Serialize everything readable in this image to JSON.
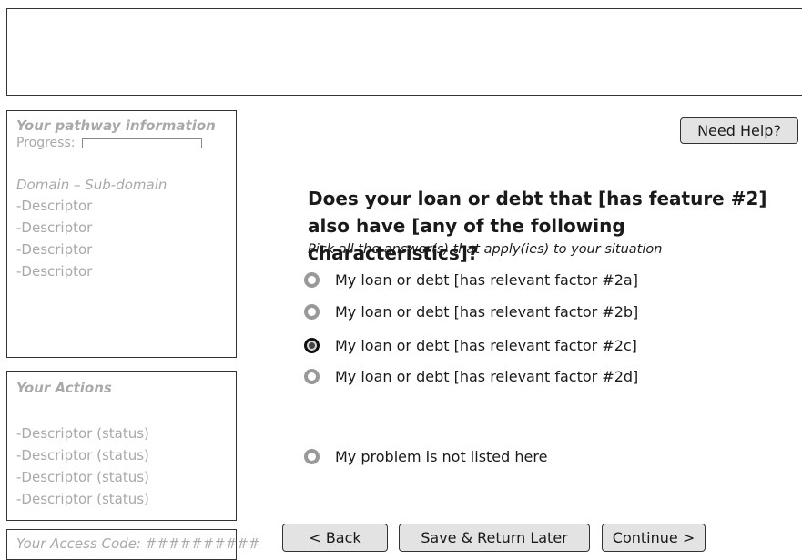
{
  "sidebar": {
    "pathway_title": "Your pathway information",
    "progress_label": "Progress:",
    "domain": "Domain – Sub-domain",
    "descriptors": [
      "-Descriptor",
      "-Descriptor",
      "-Descriptor",
      "-Descriptor"
    ],
    "actions_title": "Your Actions",
    "actions": [
      "-Descriptor (status)",
      "-Descriptor (status)",
      "-Descriptor (status)",
      "-Descriptor (status)"
    ],
    "access_code": "Your Access Code: ##########"
  },
  "help_button": "Need Help?",
  "question": {
    "title": "Does your loan or debt that [has feature #2] also have [any of the following characteristics]?",
    "instruction": "Pick all the answer(s) that apply(ies) to your situation",
    "options": [
      {
        "label": "My loan or debt [has relevant factor #2a]",
        "selected": false
      },
      {
        "label": "My loan or debt [has relevant factor #2b]",
        "selected": false
      },
      {
        "label": "My loan or debt [has relevant factor #2c]",
        "selected": true
      },
      {
        "label": "My loan or debt [has relevant factor #2d]",
        "selected": false
      },
      {
        "label": "My problem is not listed here",
        "selected": false
      }
    ]
  },
  "nav": {
    "back": "< Back",
    "save": "Save & Return Later",
    "continue": "Continue >"
  },
  "colors": {
    "muted_text": "#a9a9a9",
    "button_bg": "#e3e3e3",
    "radio_border": "#999999",
    "border": "#333333"
  },
  "icons": {
    "radio_unselected": "radio-unselected-icon",
    "radio_selected": "radio-selected-icon"
  }
}
